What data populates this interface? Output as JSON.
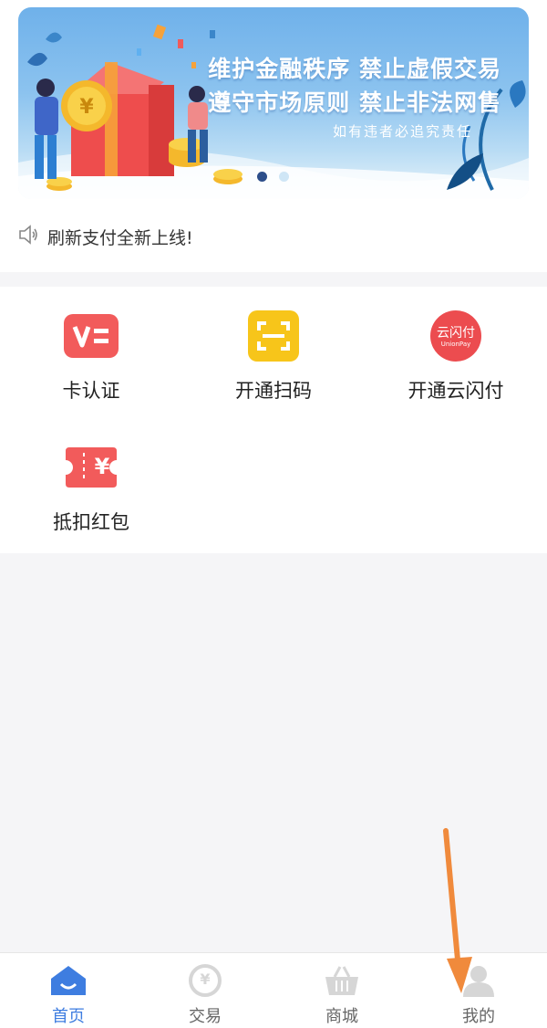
{
  "banner": {
    "headline_line1": "维护金融秩序  禁止虚假交易",
    "headline_line2": "遵守市场原则  禁止非法网售",
    "subtitle": "如有违者必追究责任",
    "active_slide": 1,
    "slide_count": 2
  },
  "notice": {
    "icon": "speaker-icon",
    "text": "刷新支付全新上线!"
  },
  "menu": {
    "items": [
      {
        "label": "卡认证",
        "icon": "card-verify-icon",
        "color": "#f25b5b"
      },
      {
        "label": "开通扫码",
        "icon": "scan-icon",
        "color": "#f7c51a"
      },
      {
        "label": "开通云闪付",
        "icon": "unionpay-cloud-icon",
        "color": "#ec4c4f",
        "icon_text": "云闪付",
        "icon_subtext": "UnionPay"
      },
      {
        "label": "抵扣红包",
        "icon": "coupon-icon",
        "color": "#f25b5b",
        "icon_text": "¥"
      }
    ]
  },
  "tabbar": {
    "items": [
      {
        "label": "首页",
        "icon": "home-icon",
        "active": true
      },
      {
        "label": "交易",
        "icon": "yen-coin-icon",
        "active": false,
        "icon_text": "¥"
      },
      {
        "label": "商城",
        "icon": "basket-icon",
        "active": false
      },
      {
        "label": "我的",
        "icon": "person-icon",
        "active": false
      }
    ]
  },
  "colors": {
    "accent": "#3e7de0",
    "arrow": "#f08a3c",
    "background": "#f5f5f7"
  }
}
